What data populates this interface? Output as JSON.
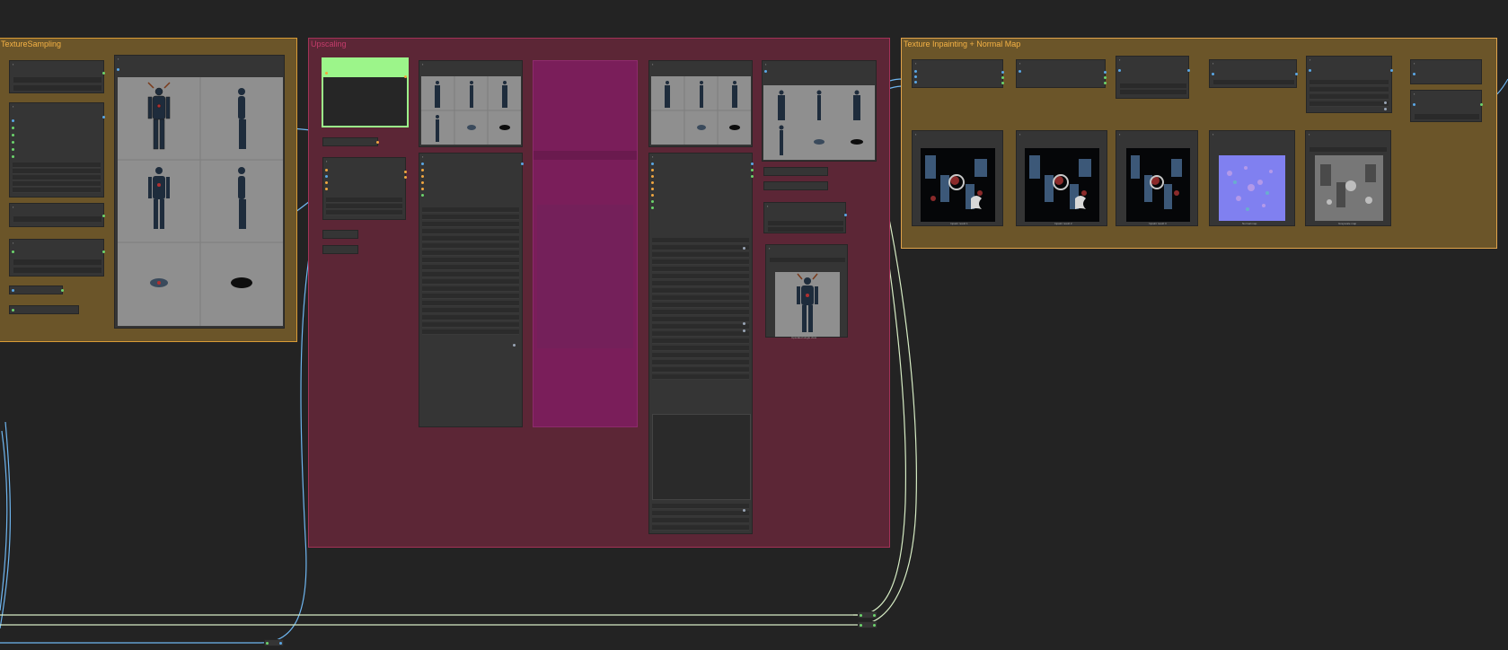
{
  "groups": {
    "texture_sampling": {
      "title": "TextureSampling",
      "color": "#d99b35"
    },
    "upscaling": {
      "title": "Upscaling",
      "color": "#c43c6b"
    },
    "inpainting": {
      "title": "Texture Inpainting + Normal Map",
      "color": "#e0a34b"
    }
  },
  "colors": {
    "canvas": "#232323",
    "node": "#353535",
    "wire_blue": "#6fb6f0",
    "wire_orange": "#f0a640",
    "wire_pale": "#d6ecc4",
    "wire_purple": "#9c7cf0",
    "port_green": "#6cd46c",
    "port_blue": "#5aa7e6",
    "highlight_node": "#9cf58a",
    "bypass_node": "#7a1e5a"
  },
  "preview_captions": {
    "upscaled_single": "Upscaled single view",
    "inpaint_1": "Inpaint result 1",
    "inpaint_2": "Inpaint result 2",
    "inpaint_3": "Inpaint result 3",
    "normal_map": "Normal map",
    "grayscale": "Grayscale map"
  }
}
